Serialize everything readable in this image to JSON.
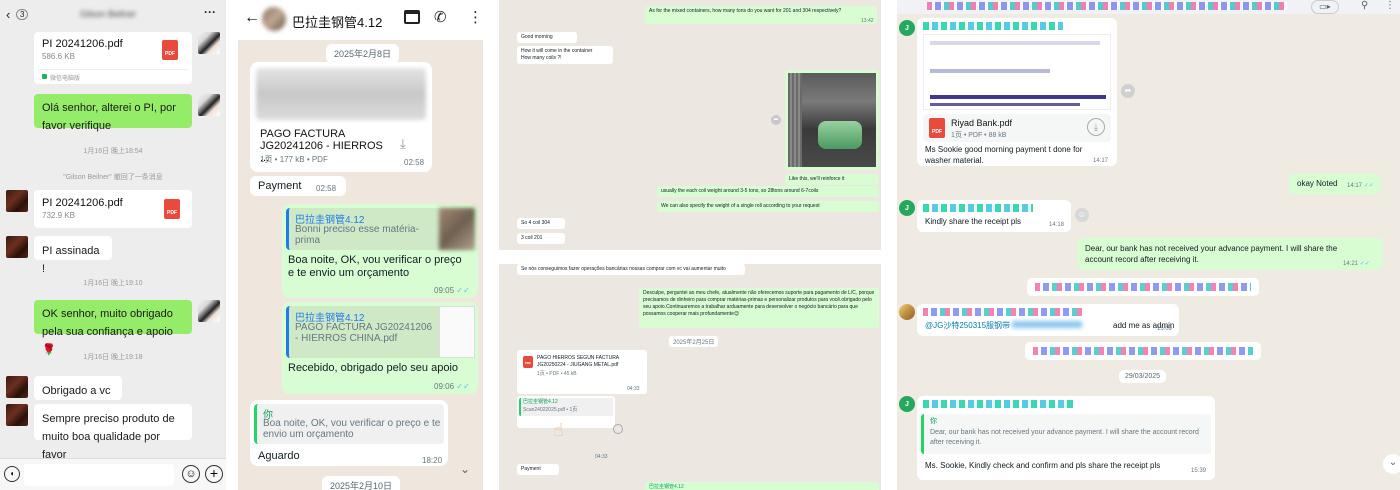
{
  "panel1": {
    "unread_badge": "3",
    "contact_name": "Gilson Beilner",
    "more": "···",
    "file1": {
      "name": "PI 20241206.pdf",
      "size": "586.6 KB",
      "source": "微信电脑版"
    },
    "msg1": "Olá senhor, alterei o PI, por favor verifique",
    "time1": "1月16日 晚上18:54",
    "recall": "\"Gilson Beilner\" 撤回了一条消息",
    "file2": {
      "name": "PI 20241206.pdf",
      "size": "732.9 KB"
    },
    "msg2": "PI assinada !",
    "time2": "1月16日 晚上19:10",
    "msg3": "OK senhor, muito obrigado pela sua confiança e apoio🌹",
    "time3": "1月16日 晚上19:18",
    "msg4": "Obrigado a vc",
    "msg5": "Sempre preciso produto de muito boa qualidade por favor",
    "pdf_label": "PDF"
  },
  "panel2": {
    "chat_title": "巴拉圭钢管4.12",
    "date1": "2025年2月8日",
    "doc1": {
      "name": "PAGO FACTURA JG20241206 - HIERROS ...",
      "meta": "1页 • 177 kB • PDF",
      "time": "02:58"
    },
    "msg_payment": "Payment",
    "msg_payment_time": "02:58",
    "reply1": {
      "quote_author": "巴拉圭钢管4.12",
      "quote_text": "Bonni preciso esse matéria-prima",
      "text": "Boa noite, OK, vou verificar o preço e te envio um orçamento",
      "time": "09:05"
    },
    "reply2": {
      "quote_author": "巴拉圭钢管4.12",
      "quote_text": "PAGO FACTURA JG20241206 - HIERROS CHINA.pdf",
      "text": "Recebido, obrigado pelo seu apoio",
      "time": "09:06"
    },
    "reply3": {
      "quote_author": "你",
      "quote_text": "Boa noite, OK, vou verificar o preço e te envio um orçamento",
      "text": "Aguardo",
      "time": "18:20"
    },
    "date2": "2025年2月10日"
  },
  "panel3": {
    "m_containers": "As for the mixed containers, how many tons do you want for 201 and 304 respectively?",
    "m_containers_t": "13:42",
    "m_morning": "Good morning",
    "m_morning_t": "14:14",
    "m_how": "How it will come in the container\nHow many coils ?!",
    "m_how_t": "14:15",
    "photo_t": "14:16",
    "m_reinforce": "Like this, we'll reinforce it",
    "m_weight": "usually the each coil weight around 3-5 tons, so 28tons around 6-7coils",
    "m_specify": "We can also specify the weight of a single roll according to your request",
    "m_4coil": "So 4 coil 304",
    "m_3coil": "3 coil 201",
    "m_pt1": "Se nós conseguimos fazer operações bancárias nossas comprar com vc vai aumentar muito",
    "m_pt2": "Desculpe, perguntei ao meu chefe, atualmente não oferecemos suporte para pagamento de L/C, porque precisamos de dinheiro para comprar matérias-primas e personalizar produtos para você.obrigado pelo seu apoio.Continuaremos a trabalhar arduamente para desenvolver o negócio bancário para que possamos cooperar mais profundamente😊",
    "m_pt2_t": "17:57",
    "date": "2025年2月25日",
    "doc_name": "PAGO HIERROS SEGUN FACTURA JG20250224 - JIUGANG METAL.pdf",
    "doc_meta": "1页 • PDF • 45 kB",
    "doc_t": "04:33",
    "fwd_author": "巴拉圭钢管4.12",
    "fwd_doc": "Scan24022025.pdf • 1页",
    "fwd_t": "04:33",
    "m_payment": "Payment",
    "m_payment_t": "04:34",
    "bottom_quote": "巴拉圭钢管4.12"
  },
  "panel4": {
    "doc": {
      "name": "Riyad Bank.pdf",
      "meta": "1页 • PDF • 88 kB"
    },
    "msg_sookie": "Ms  Sookie good morning payment t done for washer material.",
    "msg_sookie_t": "14:17",
    "msg_okay": "okay Noted",
    "msg_okay_t": "14:17",
    "msg_kindly": "Kindly share the receipt pls",
    "msg_kindly_t": "14:18",
    "msg_dear": "Dear, our bank has not received your advance payment. I will share the account record after receiving it.",
    "msg_dear_t": "14:21",
    "msg_admin_mention": "@JG沙特250315服钢带",
    "msg_admin_text": "add me as admin",
    "msg_admin_t": "15:09",
    "date": "29/03/2025",
    "quote_author": "你",
    "quote_text": "Dear, our bank has not received your advance payment. I will share the account record after receiving it.",
    "msg_check": "Ms. Sookie, Kindly check and confirm and pls share the receipt pls",
    "msg_check_t": "15:39",
    "avatar_letter": "J"
  }
}
